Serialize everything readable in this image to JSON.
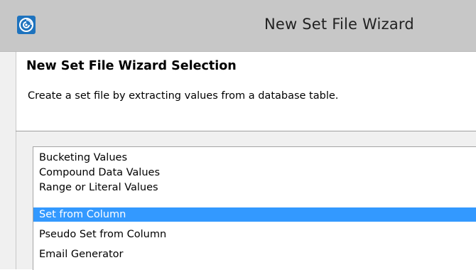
{
  "window": {
    "title": "New Set File Wizard",
    "icon": "app-swirl-icon"
  },
  "banner": {
    "title": "New Set File Wizard Selection",
    "description": "Create a set file by extracting values from a database table."
  },
  "wizard_list": {
    "items": [
      {
        "label": "Bucketing Values",
        "selected": false
      },
      {
        "label": "Compound Data Values",
        "selected": false
      },
      {
        "label": "Range or Literal Values",
        "selected": false
      },
      {
        "label": "Set from Column",
        "selected": true
      },
      {
        "label": "Pseudo Set from Column",
        "selected": false
      },
      {
        "label": "Email Generator",
        "selected": false
      }
    ]
  },
  "colors": {
    "titlebar": "#c7c7c7",
    "selection": "#3399ff",
    "icon_bg": "#1e73be"
  }
}
